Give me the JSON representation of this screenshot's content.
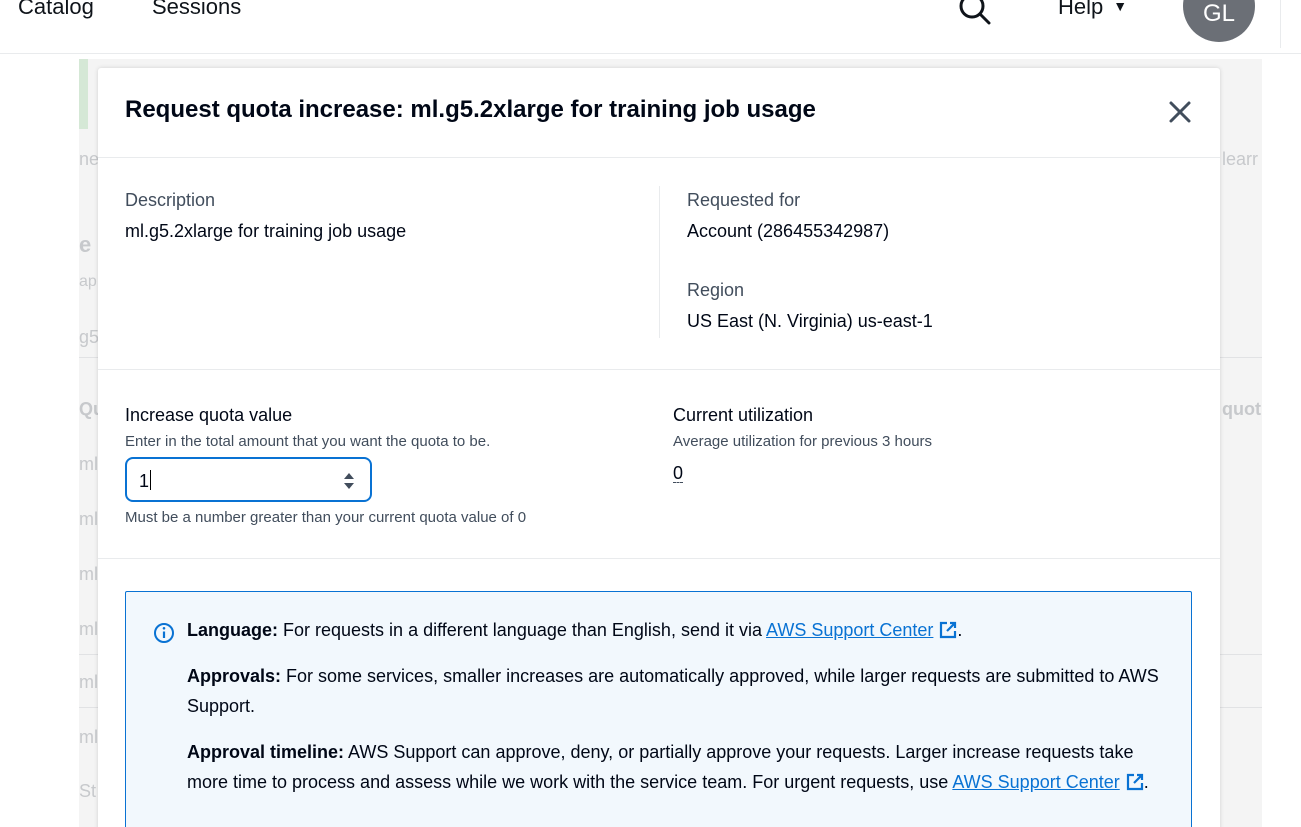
{
  "nav": {
    "items": [
      "Catalog",
      "Sessions"
    ],
    "help_label": "Help",
    "avatar_initials": "GL"
  },
  "background": {
    "ghost_texts": [
      "ne",
      "e C",
      "ap",
      "g5.",
      "Qu",
      "ml",
      "ml",
      "ml",
      "ml",
      "ml",
      "ml",
      "St",
      "learr",
      "quot"
    ]
  },
  "modal": {
    "title": "Request quota increase: ml.g5.2xlarge for training job usage",
    "description_label": "Description",
    "description_value": "ml.g5.2xlarge for training job usage",
    "requested_for_label": "Requested for",
    "requested_for_value": "Account (286455342987)",
    "region_label": "Region",
    "region_value": "US East (N. Virginia) us-east-1",
    "increase_label": "Increase quota value",
    "increase_desc": "Enter in the total amount that you want the quota to be.",
    "increase_value": "1",
    "increase_constraint": "Must be a number greater than your current quota value of 0",
    "utilization_label": "Current utilization",
    "utilization_desc": "Average utilization for previous 3 hours",
    "utilization_value": "0",
    "info": {
      "language_title": "Language:",
      "language_text": " For requests in a different language than English, send it via ",
      "language_link": "AWS Support Center",
      "approvals_title": "Approvals:",
      "approvals_text": " For some services, smaller increases are automatically approved, while larger requests are submitted to AWS Support.",
      "timeline_title": "Approval timeline:",
      "timeline_text": " AWS Support can approve, deny, or partially approve your requests. Larger increase requests take more time to process and assess while we work with the service team. For urgent requests, use ",
      "timeline_link": "AWS Support Center"
    }
  },
  "colors": {
    "accent": "#0972d3",
    "info_bg": "#f2f8fd"
  }
}
